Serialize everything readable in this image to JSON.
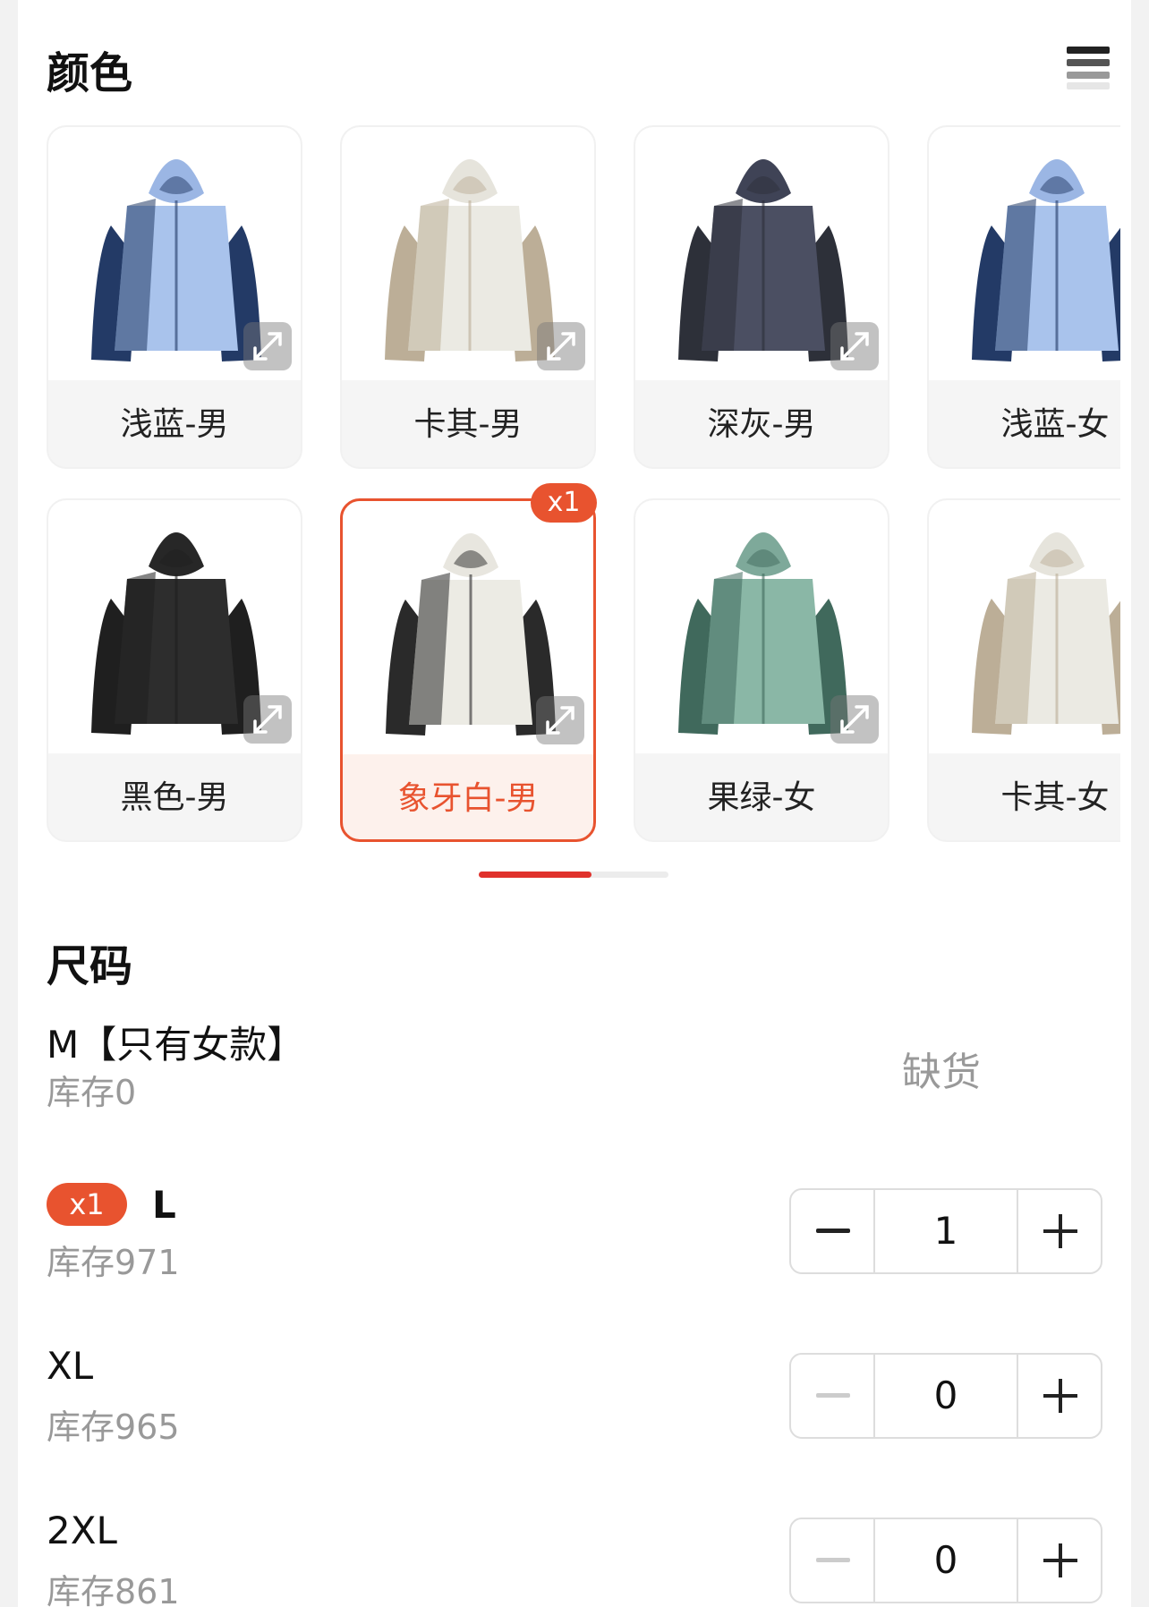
{
  "colors_section": {
    "title": "颜色",
    "list_toggle_icon": "list-view-icon",
    "options": [
      {
        "label": "浅蓝-男",
        "body": "#a9c3ec",
        "side": "#233a66",
        "hood": "#9bb6e4",
        "selected": false
      },
      {
        "label": "卡其-男",
        "body": "#ebeae3",
        "side": "#bcae97",
        "hood": "#e6e4dc",
        "selected": false
      },
      {
        "label": "深灰-男",
        "body": "#4b4f62",
        "side": "#2d3039",
        "hood": "#3f4356",
        "selected": false
      },
      {
        "label": "浅蓝-女",
        "body": "#a9c3ec",
        "side": "#233a66",
        "hood": "#9bb6e4",
        "selected": false
      },
      {
        "label": "黑色-男",
        "body": "#2d2d2d",
        "side": "#1f1f1f",
        "hood": "#272727",
        "selected": false
      },
      {
        "label": "象牙白-男",
        "body": "#ecebe4",
        "side": "#2a2a2a",
        "hood": "#e8e6df",
        "selected": true,
        "badge": "x1"
      },
      {
        "label": "果绿-女",
        "body": "#8ab7a6",
        "side": "#40695c",
        "hood": "#7ea99a",
        "selected": false
      },
      {
        "label": "卡其-女",
        "body": "#ebeae3",
        "side": "#bcae97",
        "hood": "#e6e4dc",
        "selected": false
      }
    ],
    "expand_icon": "expand-arrows-icon",
    "accent": "#e8532f",
    "scroll_indicator_color": "#e0312b"
  },
  "sizes_section": {
    "title": "尺码",
    "rows": [
      {
        "name": "M【只有女款】",
        "stock": "库存0",
        "status": "缺货",
        "quantity": null,
        "badge": null
      },
      {
        "name": "L",
        "stock": "库存971",
        "status": null,
        "quantity": "1",
        "badge": "x1"
      },
      {
        "name": "XL",
        "stock": "库存965",
        "status": null,
        "quantity": "0",
        "badge": null
      },
      {
        "name": "2XL",
        "stock": "库存861",
        "status": null,
        "quantity": "0",
        "badge": null
      }
    ]
  }
}
